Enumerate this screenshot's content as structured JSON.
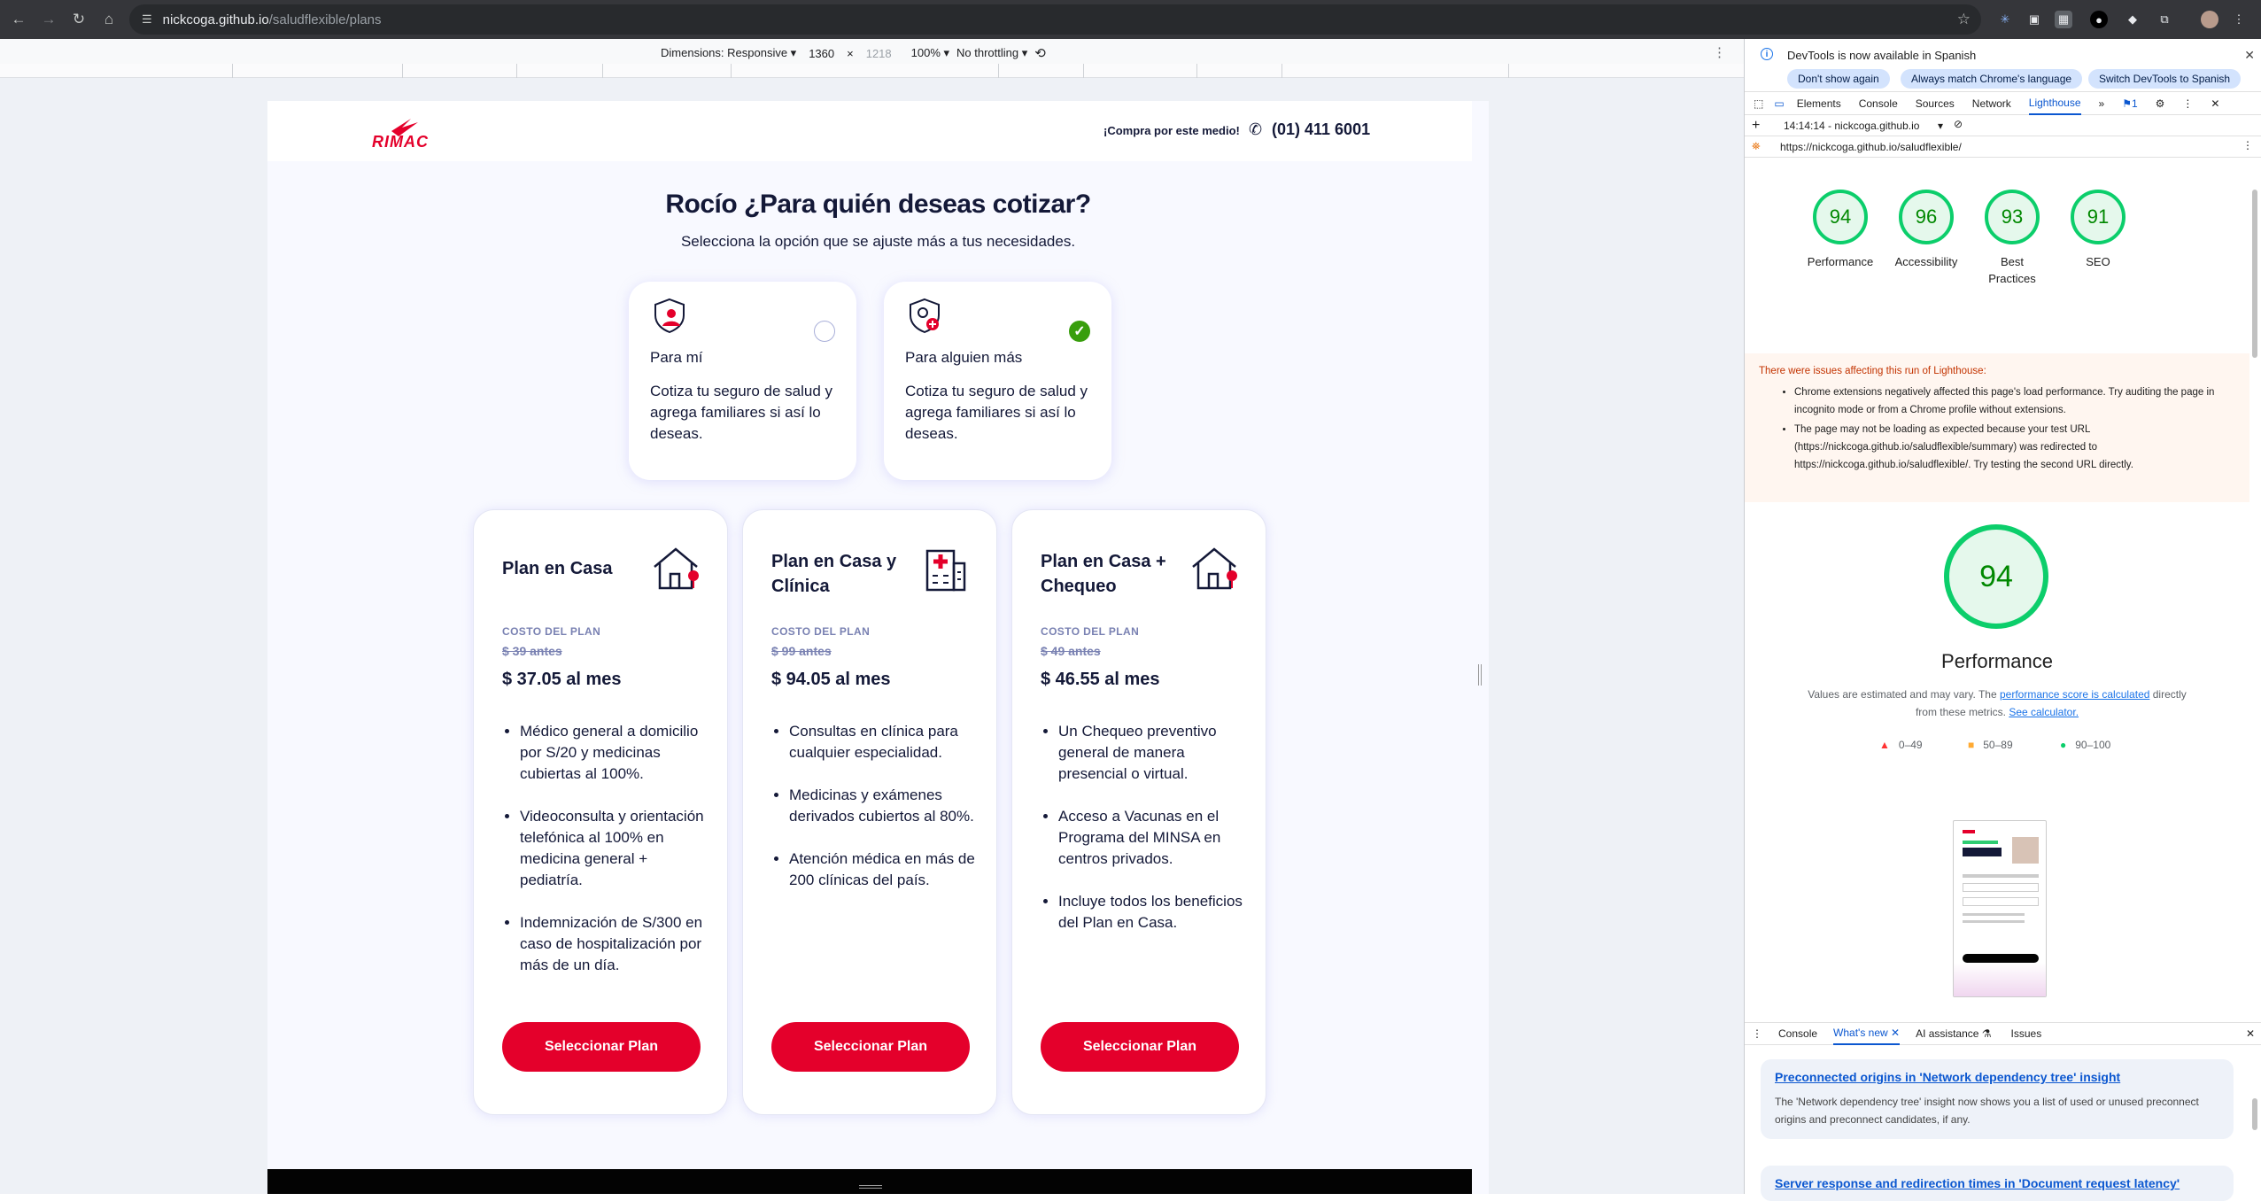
{
  "browser": {
    "url_host": "nickcoga.github.io",
    "url_path": "/saludflexible/plans"
  },
  "device_toolbar": {
    "dimensions_label": "Dimensions: Responsive ▾",
    "width": "1360",
    "times": "×",
    "height": "1218",
    "zoom": "100% ▾",
    "throttling": "No throttling ▾"
  },
  "site": {
    "logo_text": "RIMAC",
    "buy_label": "¡Compra por este medio!",
    "phone": "(01) 411 6001",
    "title": "Rocío ¿Para quién deseas cotizar?",
    "subtitle": "Selecciona la opción que se ajuste más a tus necesidades.",
    "options": [
      {
        "title": "Para mí",
        "desc": "Cotiza tu seguro de salud y agrega familiares si así lo deseas.",
        "selected": false
      },
      {
        "title": "Para alguien más",
        "desc": "Cotiza tu seguro de salud y agrega familiares si así lo deseas.",
        "selected": true
      }
    ],
    "plans": [
      {
        "name": "Plan en Casa",
        "cost_label": "COSTO DEL PLAN",
        "old_price": "$ 39 antes",
        "price": "$ 37.05 al mes",
        "benefits": [
          "Médico general a domicilio por S/20 y medicinas cubiertas al 100%.",
          "Videoconsulta y orientación telefónica al 100% en medicina general + pediatría.",
          "Indemnización de S/300 en caso de hospitalización por más de un día."
        ],
        "button": "Seleccionar Plan"
      },
      {
        "name": "Plan en Casa y Clínica",
        "cost_label": "COSTO DEL PLAN",
        "old_price": "$ 99 antes",
        "price": "$ 94.05 al mes",
        "benefits": [
          "Consultas en clínica para cualquier especialidad.",
          "Medicinas y exámenes derivados cubiertos al 80%.",
          "Atención médica en más de 200 clínicas del país."
        ],
        "button": "Seleccionar Plan"
      },
      {
        "name": "Plan en Casa + Chequeo",
        "cost_label": "COSTO DEL PLAN",
        "old_price": "$ 49 antes",
        "price": "$ 46.55 al mes",
        "benefits": [
          "Un Chequeo preventivo general de manera presencial o virtual.",
          "Acceso a Vacunas en el Programa del MINSA en centros privados.",
          "Incluye todos los beneficios del Plan en Casa."
        ],
        "button": "Seleccionar Plan"
      }
    ]
  },
  "devtools": {
    "info_text": "DevTools is now available in Spanish",
    "btn_dont_show": "Don't show again",
    "btn_match_lang": "Always match Chrome's language",
    "btn_switch": "Switch DevTools to Spanish",
    "tabs": [
      "Elements",
      "Console",
      "Sources",
      "Network",
      "Lighthouse"
    ],
    "issues_count": "1",
    "report_time": "14:14:14 - nickcoga.github.io",
    "report_url": "https://nickcoga.github.io/saludflexible/",
    "scores": [
      {
        "value": "94",
        "label": "Performance"
      },
      {
        "value": "96",
        "label": "Accessibility"
      },
      {
        "value": "93",
        "label": "Best Practices"
      },
      {
        "value": "91",
        "label": "SEO"
      }
    ],
    "warning_title": "There were issues affecting this run of Lighthouse:",
    "warnings": [
      "Chrome extensions negatively affected this page's load performance. Try auditing the page in incognito mode or from a Chrome profile without extensions.",
      "The page may not be loading as expected because your test URL (https://nickcoga.github.io/saludflexible/summary) was redirected to https://nickcoga.github.io/saludflexible/. Try testing the second URL directly."
    ],
    "perf_score": "94",
    "perf_title": "Performance",
    "perf_note_a": "Values are estimated and may vary. The ",
    "perf_note_link1": "performance score is calculated",
    "perf_note_b": " directly from these metrics. ",
    "perf_note_link2": "See calculator.",
    "legend": [
      "0–49",
      "50–89",
      "90–100"
    ],
    "legend_colors": [
      "#ff3333",
      "#ffaa33",
      "#0cce6b"
    ],
    "drawer_tabs": [
      "Console",
      "What's new",
      "AI assistance",
      "Issues"
    ],
    "news": [
      {
        "title": "Preconnected origins in 'Network dependency tree' insight",
        "desc": "The 'Network dependency tree' insight now shows you a list of used or unused preconnect origins and preconnect candidates, if any."
      },
      {
        "title": "Server response and redirection times in 'Document request latency'",
        "desc": ""
      }
    ]
  },
  "colors": {
    "brand_red": "#e4002b",
    "text_dark": "#141938",
    "pass_green": "#0cce6b"
  }
}
